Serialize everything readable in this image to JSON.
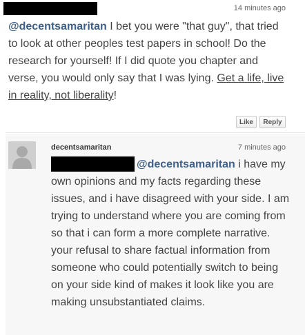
{
  "comment1": {
    "timestamp": "14 minutes ago",
    "mention": "@decentsamaritan",
    "text": " I bet you were \"that guy\", that tried to look at other peoples test papers in school! Do the research for yourself! If I did quote you chapter and verse, you would only say that I was lying. ",
    "link_text": "Get a life, live in reality, not liberality",
    "text_end": "!",
    "like_label": "Like",
    "reply_label": "Reply"
  },
  "comment2": {
    "username": "decentsamaritan",
    "timestamp": "7 minutes ago",
    "mention": "@decentsamaritan",
    "text": " i have my own opinions and my facts regarding these issues, and i have disagreed with your side. I am trying to understand where you are coming from so that i can form a more complete narrative. your refusal to share factual information from someone who could potentially switch to being on your side kind of makes it look like you are making unsubstantiated claims."
  },
  "icons": {
    "avatar": "user-silhouette-icon"
  },
  "colors": {
    "mention": "#3d5f8a",
    "text": "#444444",
    "redaction": "#000000"
  }
}
